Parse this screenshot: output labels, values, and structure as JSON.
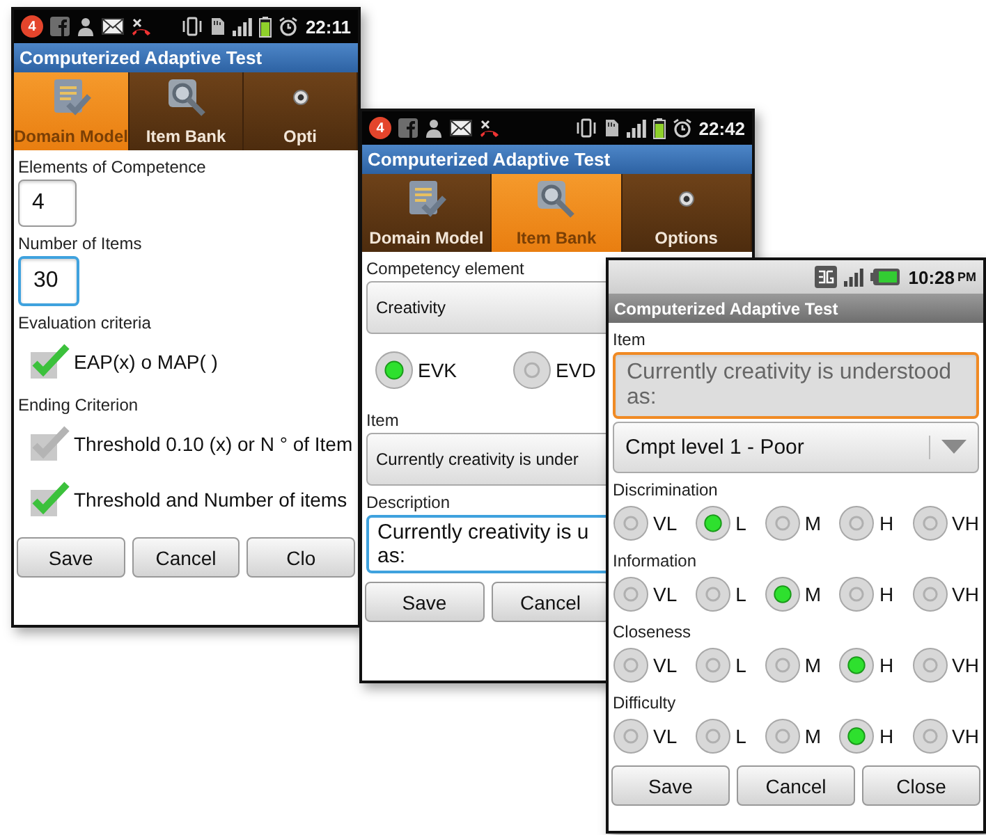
{
  "screens": [
    {
      "kind": "tabbed",
      "status_bar": {
        "badge": "4",
        "time": "22:11"
      },
      "title": "Computerized Adaptive Test",
      "tabs": [
        {
          "label": "Domain Model",
          "selected": true
        },
        {
          "label": "Item Bank",
          "selected": false
        },
        {
          "label": "Opti",
          "selected": false
        }
      ],
      "content": [
        {
          "kind": "label",
          "text": "Elements of Competence"
        },
        {
          "kind": "text_field",
          "value": "4",
          "focused": false,
          "disabled": false
        },
        {
          "kind": "label",
          "text": "Number of Items"
        },
        {
          "kind": "text_field",
          "value": "30",
          "focused": true,
          "disabled": false
        },
        {
          "kind": "label",
          "text": "Evaluation criteria"
        },
        {
          "kind": "checkbox",
          "label": "EAP(x) o MAP( )",
          "checked": true
        },
        {
          "kind": "label",
          "text": "Ending Criterion"
        },
        {
          "kind": "checkbox",
          "label": "Threshold 0.10 (x) or N ° of Item",
          "checked": false
        },
        {
          "kind": "checkbox",
          "label": "Threshold and Number of items",
          "checked": true
        }
      ],
      "buttons": [
        "Save",
        "Cancel",
        "Clo"
      ]
    },
    {
      "kind": "tabbed",
      "status_bar": {
        "badge": "4",
        "time": "22:42"
      },
      "title": "Computerized Adaptive Test",
      "tabs": [
        {
          "label": "Domain Model",
          "selected": false
        },
        {
          "label": "Item Bank",
          "selected": true
        },
        {
          "label": "Options",
          "selected": false
        }
      ],
      "content": [
        {
          "kind": "label",
          "text": "Competency element"
        },
        {
          "kind": "spinner",
          "value": "Creativity"
        },
        {
          "kind": "radio_row",
          "options": [
            {
              "label": "EVK",
              "selected": true
            },
            {
              "label": "EVD",
              "selected": false
            }
          ]
        },
        {
          "kind": "label",
          "text": "Item"
        },
        {
          "kind": "spinner",
          "value": "Currently creativity is under"
        },
        {
          "kind": "label",
          "text": "Description"
        },
        {
          "kind": "text_area",
          "lines": [
            "Currently creativity is u",
            "as:"
          ],
          "focused": true
        }
      ],
      "buttons": [
        "Save",
        "Cancel"
      ]
    },
    {
      "kind": "dialog",
      "status_bar": {
        "time": "10:28",
        "ampm": "PM"
      },
      "title": "Computerized Adaptive Test",
      "content": [
        {
          "kind": "label",
          "text": "Item"
        },
        {
          "kind": "text_field",
          "value": "Currently creativity is understood as:",
          "focused": true,
          "disabled": true
        },
        {
          "kind": "spinner",
          "value": "Cmpt level 1 - Poor"
        },
        {
          "kind": "label",
          "text": "Discrimination"
        },
        {
          "kind": "radio_row",
          "options": [
            {
              "label": "VL",
              "selected": false
            },
            {
              "label": "L",
              "selected": true
            },
            {
              "label": "M",
              "selected": false
            },
            {
              "label": "H",
              "selected": false
            },
            {
              "label": "VH",
              "selected": false
            }
          ]
        },
        {
          "kind": "label",
          "text": "Information"
        },
        {
          "kind": "radio_row",
          "options": [
            {
              "label": "VL",
              "selected": false
            },
            {
              "label": "L",
              "selected": false
            },
            {
              "label": "M",
              "selected": true
            },
            {
              "label": "H",
              "selected": false
            },
            {
              "label": "VH",
              "selected": false
            }
          ]
        },
        {
          "kind": "label",
          "text": "Closeness"
        },
        {
          "kind": "radio_row",
          "options": [
            {
              "label": "VL",
              "selected": false
            },
            {
              "label": "L",
              "selected": false
            },
            {
              "label": "M",
              "selected": false
            },
            {
              "label": "H",
              "selected": true
            },
            {
              "label": "VH",
              "selected": false
            }
          ]
        },
        {
          "kind": "label",
          "text": "Difficulty"
        },
        {
          "kind": "radio_row",
          "options": [
            {
              "label": "VL",
              "selected": false
            },
            {
              "label": "L",
              "selected": false
            },
            {
              "label": "M",
              "selected": false
            },
            {
              "label": "H",
              "selected": true
            },
            {
              "label": "VH",
              "selected": false
            }
          ]
        }
      ],
      "buttons": [
        "Save",
        "Cancel",
        "Close"
      ]
    }
  ]
}
